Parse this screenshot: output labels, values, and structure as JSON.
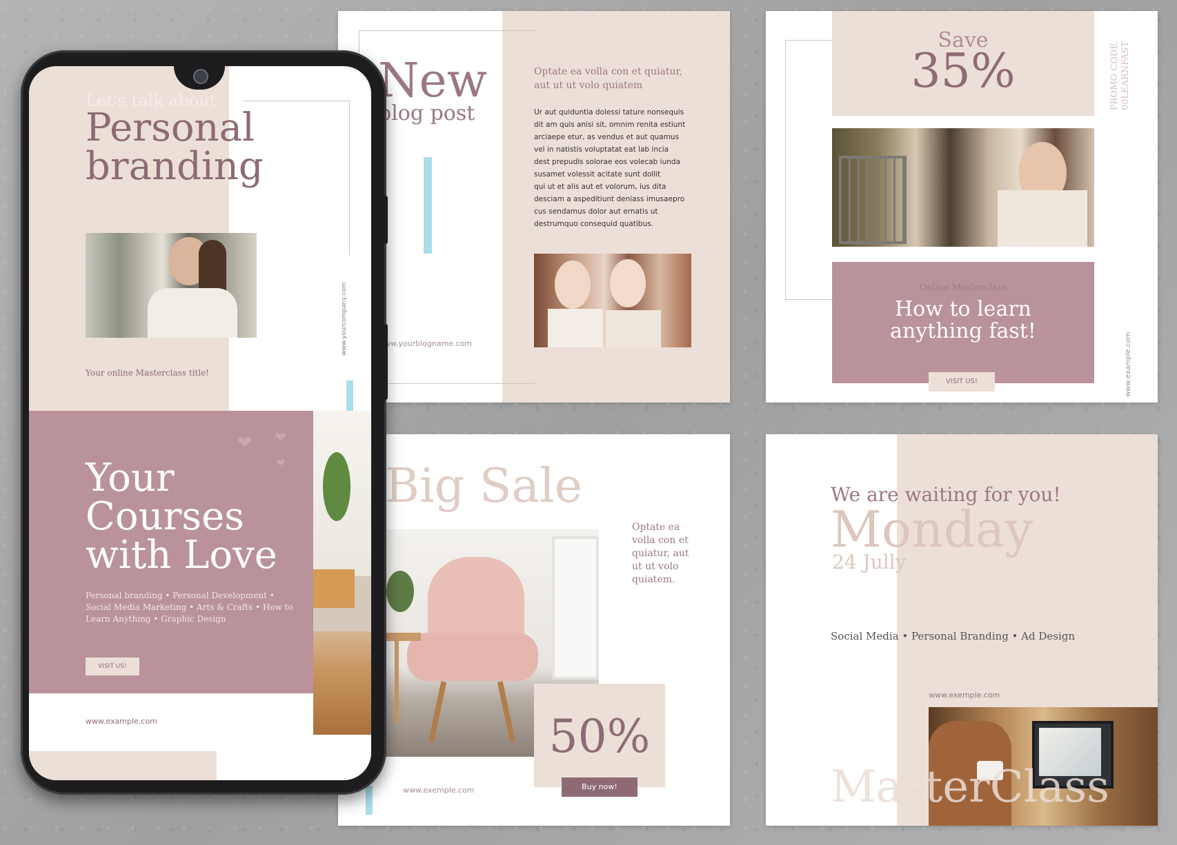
{
  "phone_screen": {
    "intro": "Let's talk about",
    "title_line1": "Personal",
    "title_line2": "branding",
    "url_vertical": "www.yourcompany.com",
    "masterclass_title": "Your online Masterclass title!",
    "headline_line1": "Your",
    "headline_line2": "Courses",
    "headline_line3": "with Love",
    "topics_line1": "Personal branding • Personal Development •",
    "topics_line2": "Social Media Marketing • Arts & Crafts • How to",
    "topics_line3": "Learn Anything • Graphic Design",
    "visit_button": "VISIT US!",
    "url": "www.example.com"
  },
  "blog_card": {
    "title": "New",
    "subtitle": "blog post",
    "lead": "Optate ea volla con et quiatur, aut ut ut volo quiatem",
    "body": [
      "Ur aut quiduntia dolessi tature nonsequis",
      "dit am quis anisi sit, omnim renita estiunt",
      "arciaepe etur, as vendus et aut quamus",
      "vel in natistis voluptatat eat lab incia",
      "dest prepudis solorae eos volecab iunda",
      "susamet volessit acitate sunt dollit",
      "qui ut et alis aut et volorum, ius dita",
      "desciam a aspeditiunt deniass imusaepro",
      "cus sendamus dolor aut ernatis ut",
      "destrumquo consequid quatibus."
    ],
    "url": "www.yourblogname.com"
  },
  "promo_card": {
    "save_label": "Save",
    "percent": "35%",
    "promo_code_line1": "PROMO CODE",
    "promo_code_line2": "00LEARNFAST",
    "kicker": "Online Masterclass",
    "headline_line1": "How to learn",
    "headline_line2": "anything fast!",
    "button": "VISIT US!",
    "url_vertical": "www.example.com"
  },
  "sale_card": {
    "title": "Big Sale",
    "text_lines": [
      "Optate ea",
      "volla con et",
      "quiatur, aut",
      "ut ut volo",
      "quiatem."
    ],
    "percent": "50%",
    "button": "Buy now!",
    "url": "www.exemple.com"
  },
  "monday_card": {
    "kicker": "We are waiting for you!",
    "day": "Monday",
    "date": "24 Jully",
    "topics": "Social Media • Personal Branding • Ad Design",
    "url": "www.exemple.com",
    "watermark": "MasterClass"
  },
  "colors": {
    "blush": "#ecdfd8",
    "mauve": "#b9929b",
    "title_mauve": "#8e6b74",
    "light_blue": "#a9dde9"
  }
}
